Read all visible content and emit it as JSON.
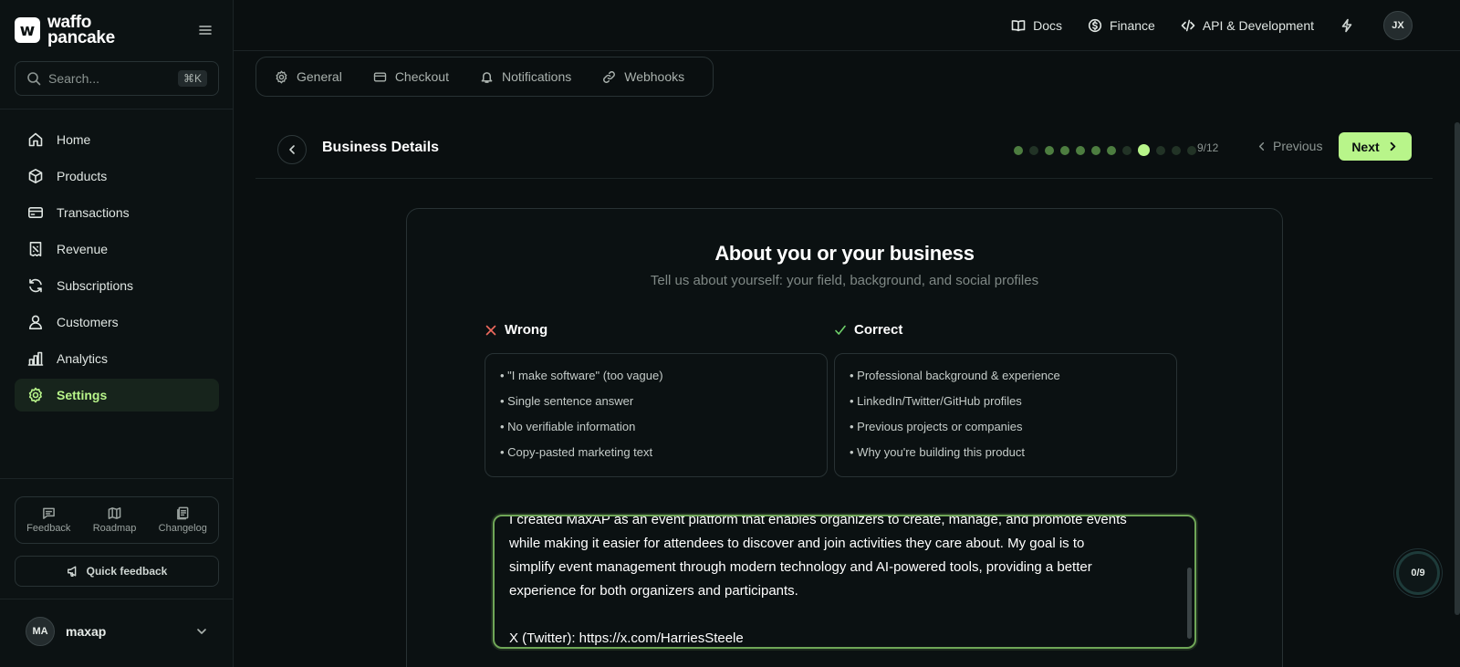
{
  "brand": {
    "line1": "waffo",
    "line2": "pancake",
    "mark": "w"
  },
  "search": {
    "placeholder": "Search...",
    "shortcut": "⌘K"
  },
  "sidebar": {
    "items": [
      {
        "label": "Home",
        "icon": "home-icon"
      },
      {
        "label": "Products",
        "icon": "box-icon"
      },
      {
        "label": "Transactions",
        "icon": "card-icon"
      },
      {
        "label": "Revenue",
        "icon": "receipt-icon"
      },
      {
        "label": "Subscriptions",
        "icon": "refresh-icon"
      },
      {
        "label": "Customers",
        "icon": "user-icon"
      },
      {
        "label": "Analytics",
        "icon": "bar-chart-icon"
      },
      {
        "label": "Settings",
        "icon": "gear-icon",
        "active": true
      }
    ],
    "footer_links": [
      {
        "label": "Feedback",
        "icon": "message-icon"
      },
      {
        "label": "Roadmap",
        "icon": "map-icon"
      },
      {
        "label": "Changelog",
        "icon": "changelog-icon"
      }
    ],
    "quick_feedback": "Quick feedback",
    "user": {
      "initials": "MA",
      "name": "maxap"
    }
  },
  "topbar": {
    "links": [
      {
        "label": "Docs",
        "icon": "book-icon"
      },
      {
        "label": "Finance",
        "icon": "dollar-icon"
      },
      {
        "label": "API & Development",
        "icon": "code-icon"
      }
    ],
    "avatar": "JX"
  },
  "settings_tabs": [
    {
      "label": "General",
      "icon": "gear-icon"
    },
    {
      "label": "Checkout",
      "icon": "card-icon"
    },
    {
      "label": "Notifications",
      "icon": "bell-icon"
    },
    {
      "label": "Webhooks",
      "icon": "link-icon"
    }
  ],
  "wizard": {
    "title": "Business Details",
    "step_current": 9,
    "step_total": 12,
    "step_label": "9/12",
    "previous": "Previous",
    "next": "Next",
    "dots": [
      "done",
      "pending",
      "done",
      "done",
      "done",
      "done",
      "done",
      "pending",
      "current",
      "pending",
      "pending",
      "pending"
    ]
  },
  "card": {
    "title": "About you or your business",
    "subtitle": "Tell us about yourself: your field, background, and social profiles",
    "wrong": {
      "heading": "Wrong",
      "items": [
        "\"I make software\" (too vague)",
        "Single sentence answer",
        "No verifiable information",
        "Copy-pasted marketing text"
      ]
    },
    "correct": {
      "heading": "Correct",
      "items": [
        "Professional background & experience",
        "LinkedIn/Twitter/GitHub profiles",
        "Previous projects or companies",
        "Why you're building this product"
      ]
    },
    "textarea_value": "I created MaxAP as an event platform that enables organizers to create, manage, and promote events\nwhile making it easier for attendees to discover and join activities they care about. My goal is to\nsimplify event management through modern technology and AI-powered tools, providing a better\nexperience for both organizers and participants.\n\nX (Twitter): https://x.com/HarriesSteele\nGitHub: https://github.com/Harries"
  },
  "progress_badge": "0/9",
  "colors": {
    "accent": "#b8f58a",
    "wrong": "#f06a5e",
    "correct": "#6fd06a",
    "background": "#0a0f10"
  }
}
